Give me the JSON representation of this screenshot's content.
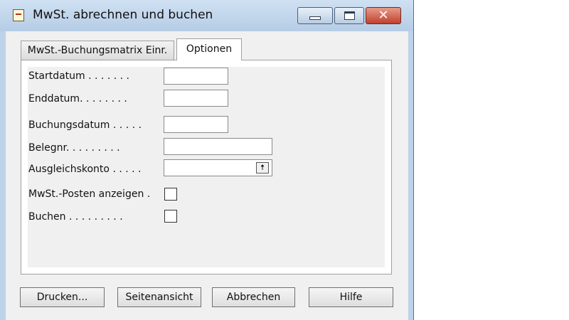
{
  "window": {
    "title": "MwSt. abrechnen und buchen",
    "close_glyph": "✕"
  },
  "tabs": [
    {
      "label": "MwSt.-Buchungsmatrix Einr."
    },
    {
      "label": "Optionen"
    }
  ],
  "fields": {
    "startdatum": {
      "label": "Startdatum . . . . . . .",
      "value": ""
    },
    "enddatum": {
      "label": "Enddatum. . . . . . . .",
      "value": ""
    },
    "buchungsdatum": {
      "label": "Buchungsdatum . . . . .",
      "value": ""
    },
    "belegnr": {
      "label": "Belegnr.  . . . . . . . .",
      "value": ""
    },
    "ausgleichskonto": {
      "label": "Ausgleichskonto . . . . .",
      "value": "",
      "lookup_glyph": "🠅"
    },
    "mwst_posten": {
      "label": "MwSt.-Posten anzeigen  .",
      "checked": false
    },
    "buchen": {
      "label": "Buchen . . . . . . . . .",
      "checked": false
    }
  },
  "buttons": {
    "drucken": "Drucken...",
    "seitenansicht": "Seitenansicht",
    "abbrechen": "Abbrechen",
    "hilfe": "Hilfe"
  },
  "icons": {
    "title": "document-icon",
    "minimize": "minimize-icon",
    "maximize": "maximize-icon",
    "close": "close-icon",
    "lookup": "arrow-up-icon"
  }
}
